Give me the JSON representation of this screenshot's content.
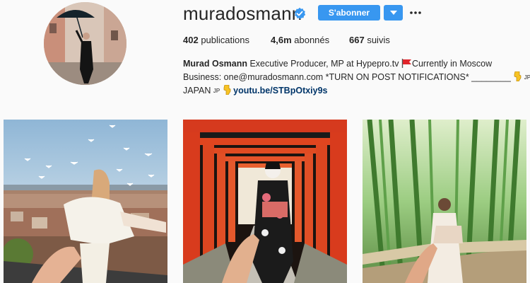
{
  "profile": {
    "username": "muradosmann",
    "verified": true,
    "follow_label": "S'abonner",
    "stats": {
      "posts_count": "402",
      "posts_label": "publications",
      "followers_count": "4,6m",
      "followers_label": "abonnés",
      "following_count": "667",
      "following_label": "suivis"
    },
    "bio": {
      "full_name": "Murad Osmann",
      "line1_text": " Executive Producer, MP at Hypepro.tv ",
      "line1_tail": "Currently in Moscow",
      "line2_text": "Business: one@muradosmann.com *TURN ON POST NOTIFICATIONS* ________ ",
      "flag_code": "JP",
      "line3_text": "JAPAN ",
      "link": "youtu.be/STBpOtxiy9s"
    }
  },
  "colors": {
    "accent": "#3897f0",
    "link": "#003569",
    "background": "#fafafa",
    "text": "#262626"
  },
  "icons": {
    "verified": "verified-badge-icon",
    "dropdown": "chevron-down-icon",
    "more": "more-options-icon",
    "flag": "red-flag-icon",
    "point": "pointing-down-hand-icon"
  },
  "posts": [
    {
      "scene": "istanbul-rooftop-seagulls"
    },
    {
      "scene": "torii-gates-kyoto"
    },
    {
      "scene": "bamboo-forest-kyoto"
    }
  ]
}
